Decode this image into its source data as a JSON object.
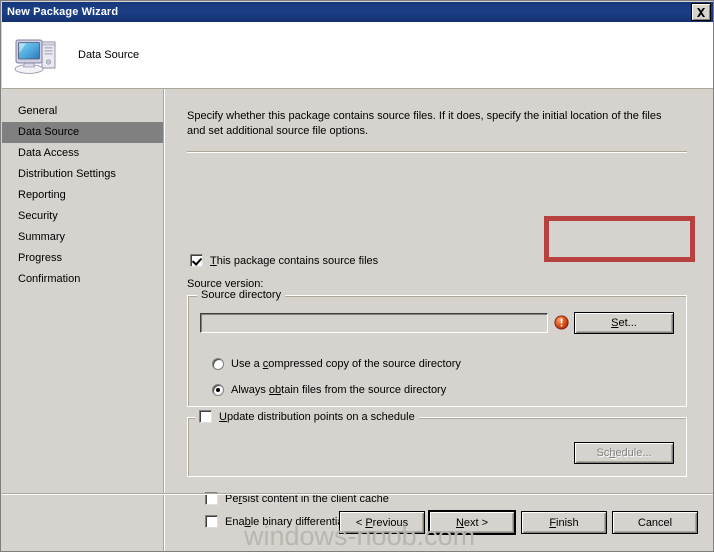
{
  "window": {
    "title": "New Package Wizard",
    "close_label": "X"
  },
  "header": {
    "icon": "computer-icon",
    "title": "Data Source"
  },
  "sidebar": {
    "items": [
      {
        "label": "General",
        "selected": false
      },
      {
        "label": "Data Source",
        "selected": true
      },
      {
        "label": "Data Access",
        "selected": false
      },
      {
        "label": "Distribution Settings",
        "selected": false
      },
      {
        "label": "Reporting",
        "selected": false
      },
      {
        "label": "Security",
        "selected": false
      },
      {
        "label": "Summary",
        "selected": false
      },
      {
        "label": "Progress",
        "selected": false
      },
      {
        "label": "Confirmation",
        "selected": false
      }
    ]
  },
  "main": {
    "description": "Specify whether this package contains source files. If it does, specify the initial location of the files and set additional source file options.",
    "contains_source_files": {
      "label_pre": "",
      "label_accel": "T",
      "label_post": "his package contains source files",
      "checked": true
    },
    "source_version_label": "Source version:",
    "source_directory_group": {
      "title": "Source directory",
      "input_value": "",
      "input_placeholder": "",
      "error_icon": "error-exclamation-icon",
      "set_button": {
        "label_pre": "",
        "label_accel": "S",
        "label_post": "et..."
      },
      "radios": [
        {
          "label_pre": "Use a ",
          "label_accel": "c",
          "label_post": "ompressed copy of the source directory",
          "checked": false
        },
        {
          "label_pre": "Always ",
          "label_accel": "ob",
          "label_post": "tain files from the source directory",
          "checked": true
        }
      ]
    },
    "update_schedule_group": {
      "title_pre": "",
      "title_accel": "U",
      "title_post": "pdate distribution points on a schedule",
      "checked": false,
      "schedule_button": {
        "label_pre": "Sc",
        "label_accel": "h",
        "label_post": "edule...",
        "disabled": true
      }
    },
    "extra_checkboxes": [
      {
        "label_pre": "Pe",
        "label_accel": "r",
        "label_post": "sist content in the client cache",
        "checked": false
      },
      {
        "label_pre": "Ena",
        "label_accel": "b",
        "label_post": "le binary differential replication",
        "checked": false
      }
    ]
  },
  "footer": {
    "previous": {
      "pre": "< ",
      "accel": "P",
      "post": "revious"
    },
    "next": {
      "pre": "",
      "accel": "N",
      "post": "ext >"
    },
    "finish": {
      "pre": "",
      "accel": "F",
      "post": "inish"
    },
    "cancel": {
      "pre": "",
      "accel": "",
      "post": "Cancel"
    }
  },
  "watermark": {
    "text": "windows-noob.com"
  },
  "annotation": {
    "highlight_color": "#b6413f",
    "target": "set-button-and-error-icon"
  },
  "colors": {
    "titlebar": "#15387b",
    "dialog_face": "#d6d3ce",
    "selection": "#808080",
    "error_red": "#cf3a20",
    "annotation_red": "#b6413f"
  }
}
